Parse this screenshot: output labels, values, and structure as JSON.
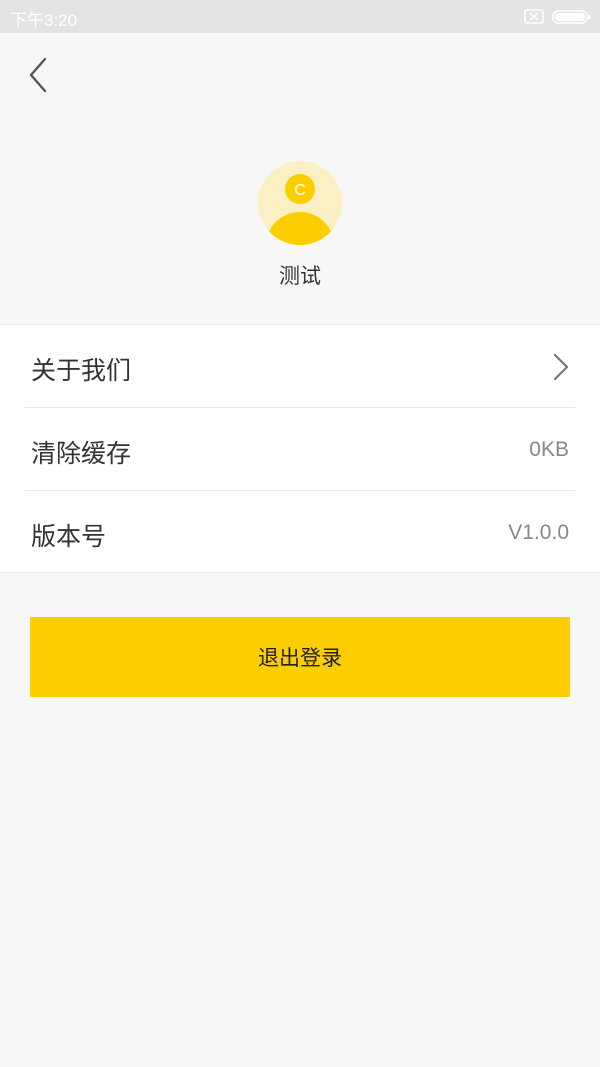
{
  "status_bar": {
    "time": "下午3:20",
    "icons": [
      "sim-icon",
      "battery-icon"
    ]
  },
  "header": {
    "back_icon": "chevron-left-icon"
  },
  "profile": {
    "avatar_initial": "C",
    "name": "测试"
  },
  "settings": {
    "items": [
      {
        "label": "关于我们",
        "value": "",
        "icon": "chevron-right-icon"
      },
      {
        "label": "清除缓存",
        "value": "0KB"
      },
      {
        "label": "版本号",
        "value": "V1.0.0"
      }
    ]
  },
  "logout": {
    "label": "退出登录"
  },
  "colors": {
    "accent": "#fcce00",
    "avatar_bg": "#fbf0c4",
    "background": "#f7f7f7",
    "status_bar": "#e3e3e3"
  }
}
